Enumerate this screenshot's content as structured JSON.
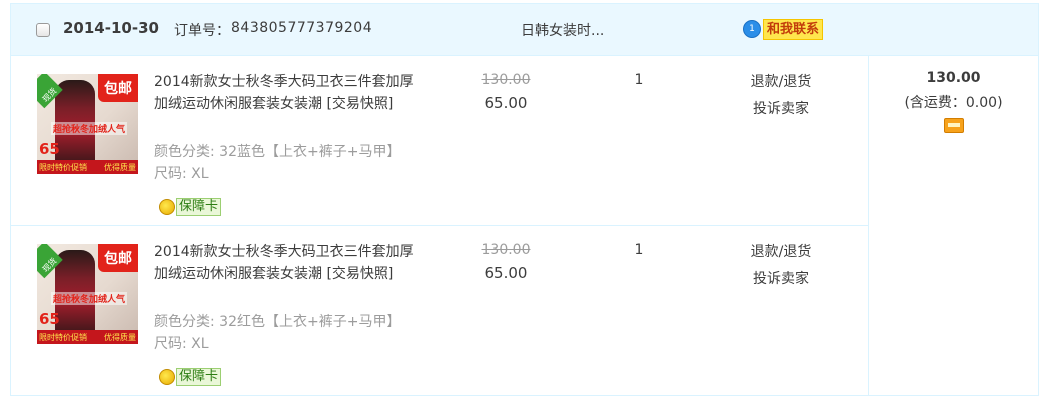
{
  "order": {
    "date": "2014-10-30",
    "order_no_label": "订单号：",
    "order_no": "843805777379204",
    "shop_name": "日韩女装时...",
    "contact_badge": "1",
    "contact_label": "和我联系",
    "total": "130.00",
    "shipping_note": "(含运费：0.00)",
    "pay_icon": "wallet-icon"
  },
  "items": [
    {
      "title": "2014新款女士秋冬季大码卫衣三件套加厚加绒运动休闲服套装女装潮 [交易快照]",
      "color": "颜色分类: 32蓝色【上衣+裤子+马甲】",
      "size": "尺码: XL",
      "guarantee": "保障卡",
      "original_price": "130.00",
      "price": "65.00",
      "quantity": "1",
      "action_refund": "退款/退货",
      "action_complain": "投诉卖家",
      "thumb": {
        "tag": "现货",
        "baoyou": "包邮",
        "slogan": "超抢秋冬加绒人气",
        "price": "65",
        "bottom_left": "限时特价促销",
        "bottom_right": "优得质量"
      }
    },
    {
      "title": "2014新款女士秋冬季大码卫衣三件套加厚加绒运动休闲服套装女装潮 [交易快照]",
      "color": "颜色分类: 32红色【上衣+裤子+马甲】",
      "size": "尺码: XL",
      "guarantee": "保障卡",
      "original_price": "130.00",
      "price": "65.00",
      "quantity": "1",
      "action_refund": "退款/退货",
      "action_complain": "投诉卖家",
      "thumb": {
        "tag": "现货",
        "baoyou": "包邮",
        "slogan": "超抢秋冬加绒人气",
        "price": "65",
        "bottom_left": "限时特价促销",
        "bottom_right": "优得质量"
      }
    }
  ],
  "colors": {
    "header_bg": "#eaf8ff",
    "border": "#daf3ff",
    "contact_bg": "#ffe64d",
    "accent_red": "#e2231a"
  }
}
